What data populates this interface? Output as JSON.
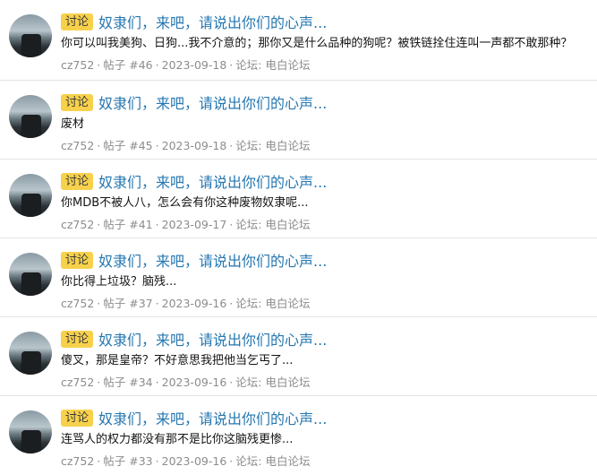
{
  "results": [
    {
      "tag": "讨论",
      "title": "奴隶们，来吧，请说出你们的心声...",
      "snippet": "你可以叫我美狗、日狗...我不介意的；那你又是什么品种的狗呢？被铁链拴住连叫一声都不敢那种？",
      "author": "cz752",
      "post": "帖子 #46",
      "date": "2023-09-18",
      "forum": "论坛: 电白论坛"
    },
    {
      "tag": "讨论",
      "title": "奴隶们，来吧，请说出你们的心声...",
      "snippet": "废材",
      "author": "cz752",
      "post": "帖子 #45",
      "date": "2023-09-18",
      "forum": "论坛: 电白论坛"
    },
    {
      "tag": "讨论",
      "title": "奴隶们，来吧，请说出你们的心声...",
      "snippet": "你MDB不被人八，怎么会有你这种废物奴隶呢...",
      "author": "cz752",
      "post": "帖子 #41",
      "date": "2023-09-17",
      "forum": "论坛: 电白论坛"
    },
    {
      "tag": "讨论",
      "title": "奴隶们，来吧，请说出你们的心声...",
      "snippet": "你比得上垃圾？脑残...",
      "author": "cz752",
      "post": "帖子 #37",
      "date": "2023-09-16",
      "forum": "论坛: 电白论坛"
    },
    {
      "tag": "讨论",
      "title": "奴隶们，来吧，请说出你们的心声...",
      "snippet": "傻叉，那是皇帝？不好意思我把他当乞丐了...",
      "author": "cz752",
      "post": "帖子 #34",
      "date": "2023-09-16",
      "forum": "论坛: 电白论坛"
    },
    {
      "tag": "讨论",
      "title": "奴隶们，来吧，请说出你们的心声...",
      "snippet": "连骂人的权力都没有那不是比你这脑残更惨...",
      "author": "cz752",
      "post": "帖子 #33",
      "date": "2023-09-16",
      "forum": "论坛: 电白论坛"
    }
  ],
  "colors": {
    "tag_bg": "#f7d14c",
    "title": "#2577b1",
    "meta": "#8c8c8c"
  },
  "icons": {
    "avatar": "user-avatar-image"
  }
}
